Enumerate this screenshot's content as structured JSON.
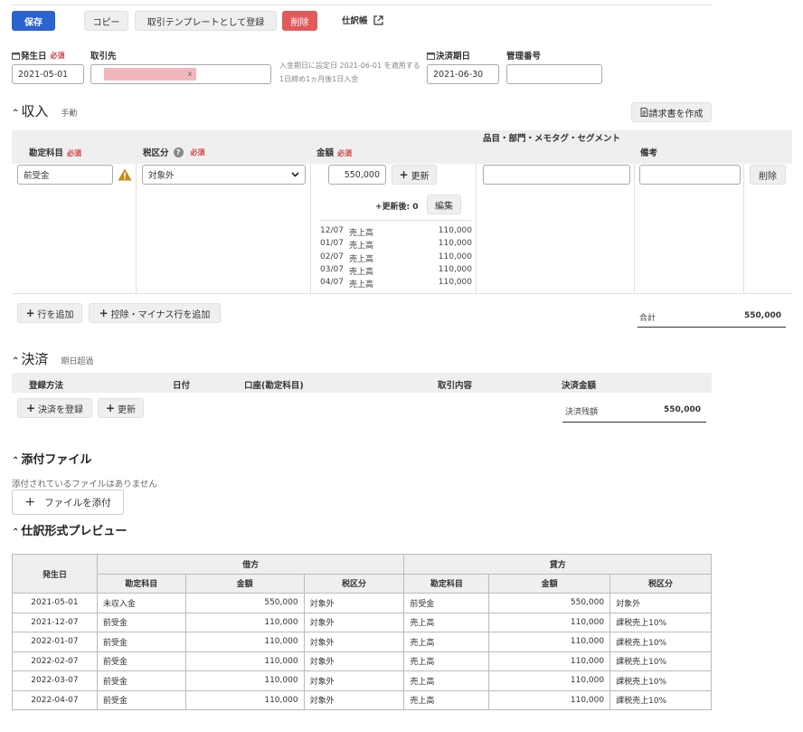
{
  "toolbar": {
    "save": "保存",
    "copy": "コピー",
    "register_template": "取引テンプレートとして登録",
    "delete": "削除",
    "journal_link": "仕訳帳"
  },
  "header": {
    "issue_date_label": "発生日",
    "required": "必須",
    "issue_date_value": "2021-05-01",
    "partner_label": "取引先",
    "partner_clear": "x",
    "partner_note_line1": "入金期日に設定日 2021-06-01 を適用する",
    "partner_note_line2": "1日締め1ヵ月後1日入金",
    "due_date_label": "決済期日",
    "due_date_value": "2021-06-30",
    "management_no_label": "管理番号",
    "management_no_value": ""
  },
  "income": {
    "title": "収入",
    "subtitle": "手動",
    "create_invoice": "請求書を作成",
    "col_account": "勘定科目",
    "col_tax": "税区分",
    "col_amount": "金額",
    "col_items": "品目・部門・メモタグ・セグメント",
    "col_notes": "備考",
    "row": {
      "account": "前受金",
      "tax": "対象外",
      "amount": "550,000",
      "update": "更新",
      "after_update": "+更新後: 0",
      "edit": "編集",
      "delete": "削除",
      "schedule": [
        {
          "date": "12/07",
          "name": "売上高",
          "value": "110,000"
        },
        {
          "date": "01/07",
          "name": "売上高",
          "value": "110,000"
        },
        {
          "date": "02/07",
          "name": "売上高",
          "value": "110,000"
        },
        {
          "date": "03/07",
          "name": "売上高",
          "value": "110,000"
        },
        {
          "date": "04/07",
          "name": "売上高",
          "value": "110,000"
        }
      ]
    },
    "add_row": "行を追加",
    "add_deduction_row": "控除・マイナス行を追加",
    "total_label": "合計",
    "total_value": "550,000"
  },
  "settlement": {
    "title": "決済",
    "subtitle": "期日超過",
    "col_method": "登録方法",
    "col_date": "日付",
    "col_account": "口座(勘定科目)",
    "col_content": "取引内容",
    "col_amount": "決済金額",
    "register_settlement": "決済を登録",
    "update": "更新",
    "balance_label": "決済残額",
    "balance_value": "550,000"
  },
  "attachments": {
    "title": "添付ファイル",
    "empty_text": "添付されているファイルはありません",
    "add_file": "ファイルを添付"
  },
  "preview": {
    "title": "仕訳形式プレビュー",
    "col_date": "発生日",
    "debit": "借方",
    "credit": "貸方",
    "col_account": "勘定科目",
    "col_amount": "金額",
    "col_tax": "税区分",
    "rows": [
      {
        "date": "2021-05-01",
        "d_acc": "未収入金",
        "d_amt": "550,000",
        "d_tax": "対象外",
        "c_acc": "前受金",
        "c_amt": "550,000",
        "c_tax": "対象外"
      },
      {
        "date": "2021-12-07",
        "d_acc": "前受金",
        "d_amt": "110,000",
        "d_tax": "対象外",
        "c_acc": "売上高",
        "c_amt": "110,000",
        "c_tax": "課税売上10%"
      },
      {
        "date": "2022-01-07",
        "d_acc": "前受金",
        "d_amt": "110,000",
        "d_tax": "対象外",
        "c_acc": "売上高",
        "c_amt": "110,000",
        "c_tax": "課税売上10%"
      },
      {
        "date": "2022-02-07",
        "d_acc": "前受金",
        "d_amt": "110,000",
        "d_tax": "対象外",
        "c_acc": "売上高",
        "c_amt": "110,000",
        "c_tax": "課税売上10%"
      },
      {
        "date": "2022-03-07",
        "d_acc": "前受金",
        "d_amt": "110,000",
        "d_tax": "対象外",
        "c_acc": "売上高",
        "c_amt": "110,000",
        "c_tax": "課税売上10%"
      },
      {
        "date": "2022-04-07",
        "d_acc": "前受金",
        "d_amt": "110,000",
        "d_tax": "対象外",
        "c_acc": "売上高",
        "c_amt": "110,000",
        "c_tax": "課税売上10%"
      }
    ]
  },
  "colors": {
    "primary": "#2b63d0",
    "danger": "#e25a5a",
    "required": "#d23c3c",
    "warning": "#c8891a",
    "redacted": "#f2b6bd"
  }
}
